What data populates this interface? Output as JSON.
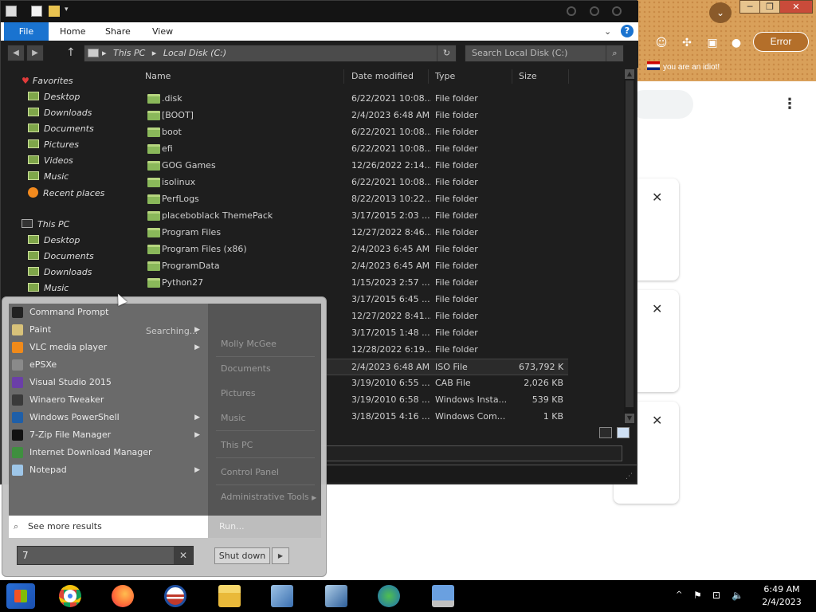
{
  "browser": {
    "error_label": "Error",
    "bookmark_label": "you are an idiot!",
    "dropdown_glyph": "⌄",
    "menu_glyph": "⋮",
    "minimize_glyph": "─",
    "maximize_glyph": "❐",
    "close_glyph": "✕",
    "card_close_glyph": "✕"
  },
  "explorer": {
    "ribbon": {
      "file": "File",
      "home": "Home",
      "share": "Share",
      "view": "View",
      "collapse_glyph": "⌄",
      "help_glyph": "?"
    },
    "address": {
      "back_glyph": "◀",
      "forward_glyph": "▶",
      "up_glyph": "↑",
      "breadcrumb_sep": "▸",
      "path_1": "This PC",
      "path_2": "Local Disk (C:)",
      "refresh_glyph": "↻",
      "search_placeholder": "Search Local Disk (C:)",
      "search_glyph": "⌕"
    },
    "nav": {
      "favorites": "Favorites",
      "fav_items": [
        "Desktop",
        "Downloads",
        "Documents",
        "Pictures",
        "Videos",
        "Music",
        "Recent places"
      ],
      "this_pc": "This PC",
      "pc_items": [
        "Desktop",
        "Documents",
        "Downloads",
        "Music"
      ]
    },
    "columns": {
      "name": "Name",
      "date": "Date modified",
      "type": "Type",
      "size": "Size"
    },
    "rows": [
      {
        "name": ".disk",
        "date": "6/22/2021 10:08...",
        "type": "File folder",
        "size": ""
      },
      {
        "name": "[BOOT]",
        "date": "2/4/2023 6:48 AM",
        "type": "File folder",
        "size": ""
      },
      {
        "name": "boot",
        "date": "6/22/2021 10:08...",
        "type": "File folder",
        "size": ""
      },
      {
        "name": "efi",
        "date": "6/22/2021 10:08...",
        "type": "File folder",
        "size": ""
      },
      {
        "name": "GOG Games",
        "date": "12/26/2022 2:14...",
        "type": "File folder",
        "size": ""
      },
      {
        "name": "isolinux",
        "date": "6/22/2021 10:08...",
        "type": "File folder",
        "size": ""
      },
      {
        "name": "PerfLogs",
        "date": "8/22/2013 10:22...",
        "type": "File folder",
        "size": ""
      },
      {
        "name": "placeboblack ThemePack",
        "date": "3/17/2015 2:03 ...",
        "type": "File folder",
        "size": ""
      },
      {
        "name": "Program Files",
        "date": "12/27/2022 8:46...",
        "type": "File folder",
        "size": ""
      },
      {
        "name": "Program Files (x86)",
        "date": "2/4/2023 6:45 AM",
        "type": "File folder",
        "size": ""
      },
      {
        "name": "ProgramData",
        "date": "2/4/2023 6:45 AM",
        "type": "File folder",
        "size": ""
      },
      {
        "name": "Python27",
        "date": "1/15/2023 2:57 ...",
        "type": "File folder",
        "size": ""
      },
      {
        "name": "",
        "date": "3/17/2015 6:45 ...",
        "type": "File folder",
        "size": ""
      },
      {
        "name": "",
        "date": "12/27/2022 8:41...",
        "type": "File folder",
        "size": ""
      },
      {
        "name": "",
        "date": "3/17/2015 1:48 ...",
        "type": "File folder",
        "size": ""
      },
      {
        "name": "",
        "date": "12/28/2022 6:19...",
        "type": "File folder",
        "size": ""
      },
      {
        "name": "",
        "date": "2/4/2023 6:48 AM",
        "type": "ISO File",
        "size": "673,792 KB"
      },
      {
        "name": "",
        "date": "3/19/2010 6:55 ...",
        "type": "CAB File",
        "size": "2,026 KB"
      },
      {
        "name": "",
        "date": "3/19/2010 6:58 ...",
        "type": "Windows Insta...",
        "size": "539 KB"
      },
      {
        "name": "",
        "date": "3/18/2015 4:16 ...",
        "type": "Windows Com...",
        "size": "1 KB"
      }
    ]
  },
  "startmenu": {
    "programs": [
      {
        "label": "Command Prompt",
        "arrow": "",
        "color": "#222222"
      },
      {
        "label": "Paint",
        "arrow": "▶",
        "color": "#d8c27a"
      },
      {
        "label": "VLC media player",
        "arrow": "▶",
        "color": "#f08a1a"
      },
      {
        "label": "ePSXe",
        "arrow": "",
        "color": "#8a8a8a"
      },
      {
        "label": "Visual Studio 2015",
        "arrow": "",
        "color": "#6b3fa8"
      },
      {
        "label": "Winaero Tweaker",
        "arrow": "",
        "color": "#3a3a3a"
      },
      {
        "label": "Windows PowerShell",
        "arrow": "▶",
        "color": "#1f5fa8"
      },
      {
        "label": "7-Zip File Manager",
        "arrow": "▶",
        "color": "#111111"
      },
      {
        "label": "Internet Download Manager",
        "arrow": "",
        "color": "#3f8f3f"
      },
      {
        "label": "Notepad",
        "arrow": "▶",
        "color": "#9ec6e8"
      }
    ],
    "searching": "Searching...",
    "links": [
      "Molly McGee",
      "Documents",
      "Pictures",
      "Music",
      "This PC",
      "Control Panel",
      "Administrative Tools"
    ],
    "admin_arrow": "▶",
    "see_more": "See more results",
    "search_glyph": "⌕",
    "run": "Run...",
    "search_value": "7",
    "clear_glyph": "✕",
    "shutdown": "Shut down",
    "shutdown_arrow": "▶"
  },
  "taskbar": {
    "time": "6:49 AM",
    "date": "2/4/2023",
    "tray_up": "^",
    "tray_flag": "⚑",
    "tray_network": "⊡",
    "tray_volume": "🔈"
  }
}
